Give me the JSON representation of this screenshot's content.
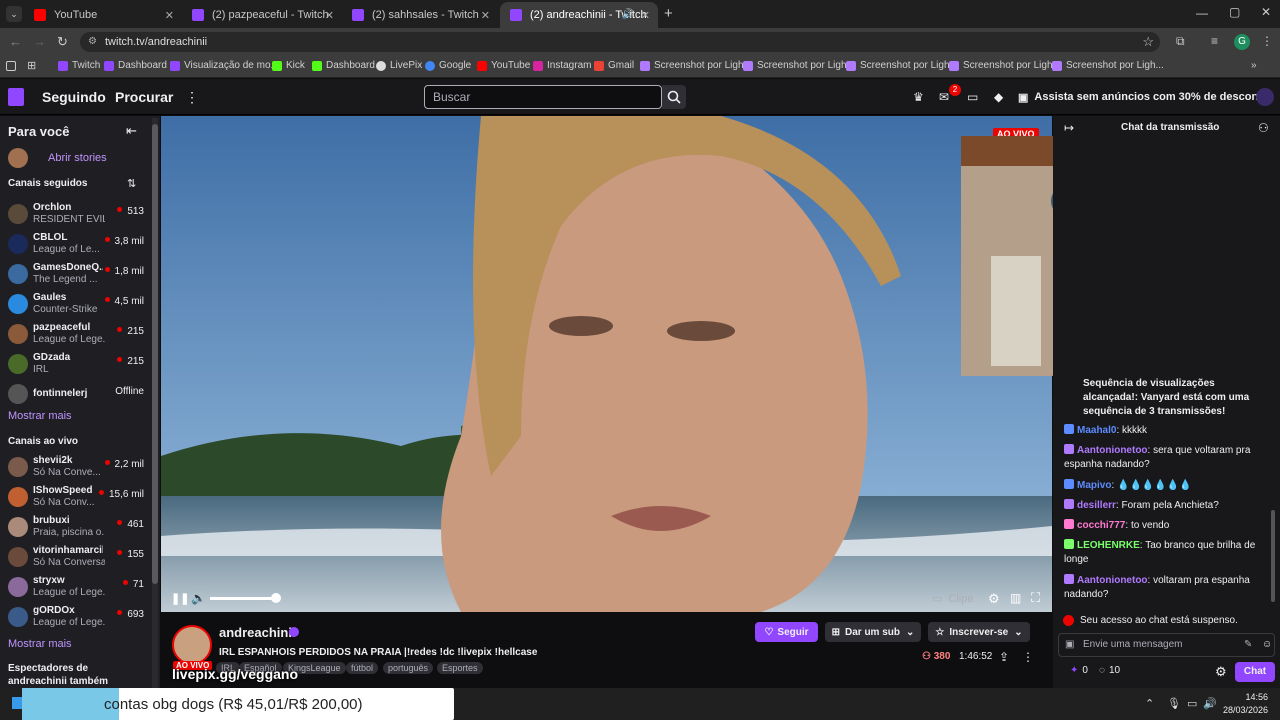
{
  "browser": {
    "tabs": [
      {
        "title": "YouTube",
        "color": "#ff0000"
      },
      {
        "title": "(2) pazpeaceful - Twitch",
        "color": "#9146ff"
      },
      {
        "title": "(2) sahhsales - Twitch",
        "color": "#9146ff"
      },
      {
        "title": "(2) andreachinii - Twitch",
        "color": "#9146ff"
      }
    ],
    "url": "twitch.tv/andreachinii",
    "profile_initial": "G",
    "bookmarks": [
      "Twitch",
      "Dashboard",
      "Visualização de mo...",
      "Kick",
      "Dashboard",
      "LivePix",
      "Google",
      "YouTube",
      "Instagram",
      "Gmail",
      "Screenshot por Ligh...",
      "Screenshot por Ligh...",
      "Screenshot por Ligh...",
      "Screenshot por Ligh..."
    ]
  },
  "topnav": {
    "following": "Seguindo",
    "browse": "Procurar",
    "search_placeholder": "Buscar",
    "notif_count": "2",
    "promo": "Assista sem anúncios com 30% de desconto"
  },
  "sidebar": {
    "for_you": "Para você",
    "stories": "Abrir stories",
    "followed": "Canais seguidos",
    "followed_channels": [
      {
        "name": "Orchlon",
        "game": "RESIDENT EVIL...",
        "viewers": "513",
        "color": "#5a4a3a"
      },
      {
        "name": "CBLOL",
        "game": "League of Le...",
        "viewers": "3,8 mil",
        "color": "#1a2a5a"
      },
      {
        "name": "GamesDoneQ...",
        "game": "The Legend ...",
        "viewers": "1,8 mil",
        "color": "#3a6aa0"
      },
      {
        "name": "Gaules",
        "game": "Counter-Strike",
        "viewers": "4,5 mil",
        "color": "#2a8adf"
      },
      {
        "name": "pazpeaceful",
        "game": "League of Lege...",
        "viewers": "215",
        "color": "#8a5a3a"
      },
      {
        "name": "GDzada",
        "game": "IRL",
        "viewers": "215",
        "color": "#4a6a2a"
      },
      {
        "name": "fontinnelerj",
        "game": "",
        "viewers": "Offline",
        "color": "#555"
      }
    ],
    "show_more": "Mostrar mais",
    "live": "Canais ao vivo",
    "live_channels": [
      {
        "name": "shevii2k",
        "game": "Só Na Conve...",
        "viewers": "2,2 mil",
        "color": "#7a5a4a"
      },
      {
        "name": "IShowSpeed",
        "game": "Só Na Conv...",
        "viewers": "15,6 mil",
        "color": "#c06030"
      },
      {
        "name": "brubuxi",
        "game": "Praia, piscina o...",
        "viewers": "461",
        "color": "#aa8a7a"
      },
      {
        "name": "vitorinhamarcilio",
        "game": "Só Na Conversa",
        "viewers": "155",
        "color": "#6a4a3a"
      },
      {
        "name": "stryxw",
        "game": "League of Lege...",
        "viewers": "71",
        "color": "#8a6a9a"
      },
      {
        "name": "gORDOx",
        "game": "League of Lege...",
        "viewers": "693",
        "color": "#3a5a8a"
      }
    ],
    "show_more2": "Mostrar mais",
    "also_watch": "Espectadores de andreachinii também assistem"
  },
  "player": {
    "live": "AO VIVO",
    "clip": "Clipe"
  },
  "stream": {
    "channel": "andreachinii",
    "title": "IRL ESPANHOIS PERDIDOS NA PRAIA |!redes !dc !livepix !hellcase",
    "live": "AO VIVO",
    "tags": [
      "IRL",
      "Español",
      "KingsLeague",
      "fútbol",
      "português",
      "Esportes"
    ],
    "follow": "Seguir",
    "gift": "Dar um sub",
    "subscribe": "Inscrever-se",
    "viewers": "380",
    "uptime": "1:46:52",
    "overlay": "livepix.gg/veggano"
  },
  "chat": {
    "title": "Chat da transmissão",
    "messages": [
      {
        "user": "",
        "text": "Sequência de visualizações alcançada!: Vanyard está com uma sequência de 3 transmissões!",
        "color": "#efeff1"
      },
      {
        "user": "Maahal0",
        "text": "kkkkk",
        "color": "#5c8cff"
      },
      {
        "user": "Aantonionetoo",
        "text": "sera que voltaram pra espanha nadando?",
        "color": "#b07aff"
      },
      {
        "user": "Mapivo",
        "text": "💧💧💧💧💧💧",
        "color": "#5c8cff"
      },
      {
        "user": "desillerr",
        "text": "Foram pela Anchieta?",
        "color": "#b07aff"
      },
      {
        "user": "cocchi777",
        "text": "to vendo",
        "color": "#ff7ad0"
      },
      {
        "user": "LEOHENRKE",
        "text": "Tao branco que brilha de longe",
        "color": "#7aff6a"
      },
      {
        "user": "Aantonionetoo",
        "text": "voltaram pra espanha nadando?",
        "color": "#b07aff"
      }
    ],
    "suspended": "Seu acesso ao chat está suspenso.",
    "placeholder": "Envie uma mensagem",
    "points": "0",
    "bits": "10",
    "chat_btn": "Chat"
  },
  "taskbar": {
    "ticker": "contas obg dogs (R$ 45,01/R$ 200,00)",
    "time": "14:56",
    "date": "28/03/2026"
  }
}
